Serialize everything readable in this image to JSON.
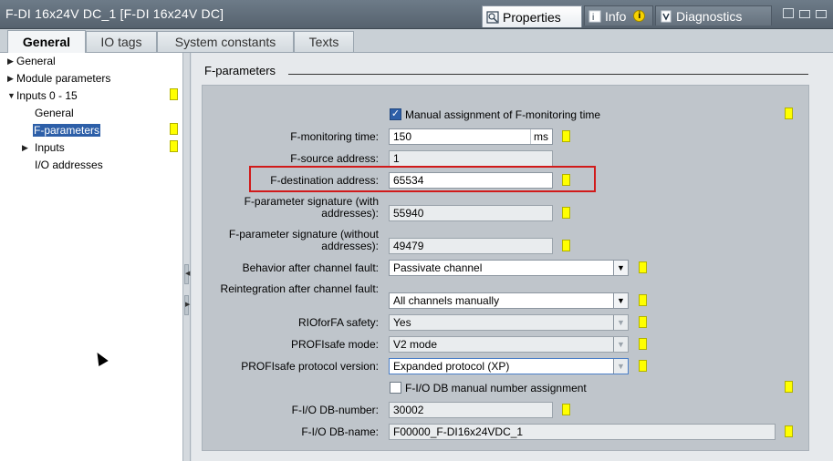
{
  "window": {
    "title": "F-DI 16x24V DC_1 [F-DI 16x24V DC]",
    "panel_tabs": [
      {
        "label": "Properties",
        "icon": "properties-icon"
      },
      {
        "label": "Info",
        "icon": "info-icon"
      },
      {
        "label": "Diagnostics",
        "icon": "diagnostics-icon"
      }
    ]
  },
  "tabs": [
    "General",
    "IO tags",
    "System constants",
    "Texts"
  ],
  "tree": {
    "items": [
      {
        "label": "General",
        "expander": "collapsed"
      },
      {
        "label": "Module parameters",
        "expander": "collapsed"
      },
      {
        "label": "Inputs 0 - 15",
        "expander": "expanded"
      },
      {
        "label": "General",
        "expander": "none"
      },
      {
        "label": "F-parameters",
        "expander": "none",
        "selected": true
      },
      {
        "label": "Inputs",
        "expander": "collapsed"
      },
      {
        "label": "I/O addresses",
        "expander": "none"
      }
    ]
  },
  "fparams": {
    "section_title": "F-parameters",
    "manual_monitoring_label": "Manual assignment of F-monitoring time",
    "manual_monitoring_checked": true,
    "rows": [
      {
        "label": "F-monitoring time:",
        "value": "150",
        "unit": "ms",
        "kind": "input"
      },
      {
        "label": "F-source address:",
        "value": "1",
        "kind": "readonly"
      },
      {
        "label": "F-destination address:",
        "value": "65534",
        "kind": "input"
      },
      {
        "label": "F-parameter signature (with addresses):",
        "value": "55940",
        "kind": "readonly"
      },
      {
        "label": "F-parameter signature (without addresses):",
        "value": "49479",
        "kind": "readonly"
      },
      {
        "label": "Behavior after channel fault:",
        "value": "Passivate channel",
        "kind": "select"
      },
      {
        "label": "Reintegration after channel fault:",
        "value": "All channels manually",
        "kind": "select"
      },
      {
        "label": "RIOforFA safety:",
        "value": "Yes",
        "kind": "select-ro"
      },
      {
        "label": "PROFIsafe mode:",
        "value": "V2 mode",
        "kind": "select-ro"
      },
      {
        "label": "PROFIsafe protocol version:",
        "value": "Expanded protocol (XP)",
        "kind": "select-ro"
      }
    ],
    "db_manual_label": "F-I/O DB manual number assignment",
    "db_manual_checked": false,
    "db_number_label": "F-I/O DB-number:",
    "db_number_value": "30002",
    "db_name_label": "F-I/O DB-name:",
    "db_name_value": "F00000_F-DI16x24VDC_1"
  },
  "colors": {
    "flag": "#ffff00",
    "selection": "#2d5fa8",
    "highlight": "#d11a1a"
  }
}
